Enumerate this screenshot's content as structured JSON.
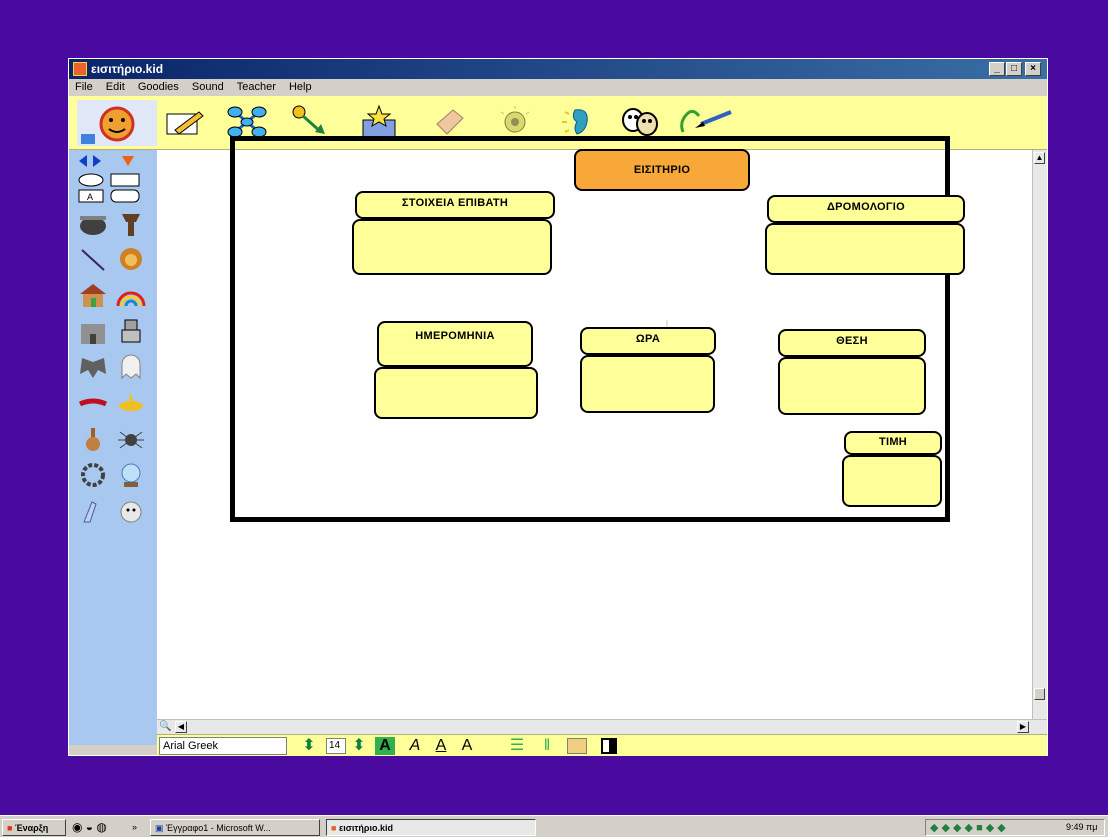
{
  "window": {
    "title": "εισιτήριο.kid",
    "min": "_",
    "max": "□",
    "close": "×"
  },
  "menu": [
    "File",
    "Edit",
    "Goodies",
    "Sound",
    "Teacher",
    "Help"
  ],
  "toolbar": {
    "tools": [
      "teacher-icon",
      "pencil-icon",
      "network-icon",
      "link-arrow-icon",
      "box-of-stars-icon",
      "eraser-icon",
      "lightbulb-icon",
      "ear-icon",
      "masks-icon",
      "paintbrush-icon"
    ]
  },
  "fontbar": {
    "font": "Arial Greek",
    "size": "14",
    "bold_label": "A",
    "italic_label": "A",
    "underline_label": "A",
    "superscript_label": "A"
  },
  "concept_map": {
    "title": "ΕΙΣΙΤΗΡΙΟ",
    "passenger": "ΣΤΟΙΧΕΙΑ ΕΠΙΒΑΤΗ",
    "route": "ΔΡΟΜΟΛΟΓΙΟ",
    "date": "ΗΜΕΡΟΜΗΝΙΑ",
    "time": "ΩΡΑ",
    "seat": "ΘΕΣΗ",
    "price": "ΤΙΜΗ"
  },
  "taskbar": {
    "start": "Έναρξη",
    "quick_more": "»",
    "task1": "Έγγραφο1 - Microsoft W...",
    "task2": "εισιτήριο.kid",
    "clock": "9:49 πμ"
  },
  "colors": {
    "desktop": "#4a0aa0",
    "toolbar": "#ffff99",
    "palette": "#a8c8f0",
    "orange": "#f8a838"
  }
}
